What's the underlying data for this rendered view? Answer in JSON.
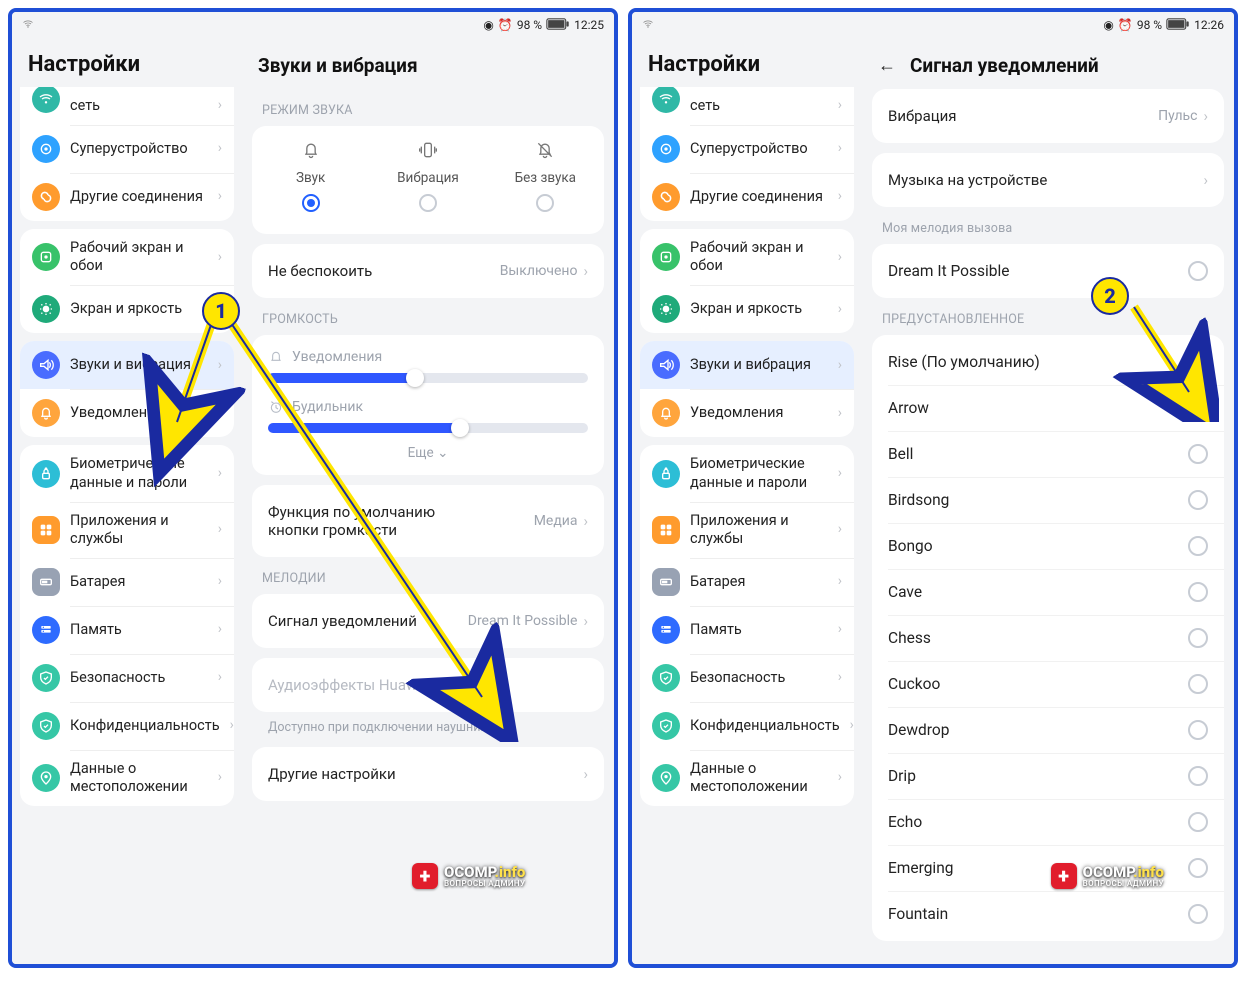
{
  "status": {
    "battery": "98 %",
    "time_left": "12:25",
    "time_right": "12:26"
  },
  "sidebar": {
    "title": "Настройки",
    "g1": [
      {
        "label": "сеть",
        "color": "i-teal",
        "half": true
      },
      {
        "label": "Суперустройство",
        "color": "i-blue2"
      },
      {
        "label": "Другие соединения",
        "color": "i-orange"
      }
    ],
    "g2": [
      {
        "label": "Рабочий экран и обои",
        "color": "i-green"
      },
      {
        "label": "Экран и яркость",
        "color": "i-dgreen"
      }
    ],
    "g3": [
      {
        "label": "Звуки и вибрация",
        "color": "i-blue",
        "active": true
      },
      {
        "label": "Уведомления",
        "color": "i-oran2"
      }
    ],
    "g4": [
      {
        "label": "Биометрические данные и пароли",
        "color": "i-cyan"
      },
      {
        "label": "Приложения и службы",
        "color": "i-orgsq"
      },
      {
        "label": "Батарея",
        "color": "i-gray"
      },
      {
        "label": "Память",
        "color": "i-bluesq"
      },
      {
        "label": "Безопасность",
        "color": "i-mint"
      },
      {
        "label": "Конфиденциальность",
        "color": "i-mint"
      },
      {
        "label": "Данные о местоположении",
        "color": "i-loc"
      }
    ]
  },
  "left_main": {
    "title": "Звуки и вибрация",
    "sound_mode_label": "РЕЖИМ ЗВУКА",
    "modes": {
      "sound": "Звук",
      "vibrate": "Вибрация",
      "silent": "Без звука"
    },
    "dnd": {
      "label": "Не беспокоить",
      "value": "Выключено"
    },
    "volume_label": "ГРОМКОСТЬ",
    "sliders": {
      "notif": "Уведомления",
      "alarm": "Будильник",
      "notif_pct": 46,
      "alarm_pct": 60
    },
    "more": "Еще",
    "vol_btn": {
      "label": "Функция по умолчанию кнопки громкости",
      "value": "Медиа"
    },
    "ringtones_label": "МЕЛОДИИ",
    "notif_sound": {
      "label": "Сигнал уведомлений",
      "value": "Dream It Possible"
    },
    "histen": {
      "label": "Аудиоэффекты Huawei Histen",
      "hint": "Доступно при подключении наушников"
    },
    "other": "Другие настройки"
  },
  "right_main": {
    "title": "Сигнал уведомлений",
    "vibration": {
      "label": "Вибрация",
      "value": "Пульс"
    },
    "music": "Музыка на устройстве",
    "my_label": "Моя мелодия вызова",
    "my_item": "Dream It Possible",
    "preset_label": "ПРЕДУСТАНОВЛЕННОЕ",
    "preset": [
      "Rise (По умолчанию)",
      "Arrow",
      "Bell",
      "Birdsong",
      "Bongo",
      "Cave",
      "Chess",
      "Cuckoo",
      "Dewdrop",
      "Drip",
      "Echo",
      "Emerging",
      "Fountain"
    ]
  },
  "annotations": {
    "num1": "1",
    "num2": "2"
  },
  "watermark": {
    "brand": "OCOMP",
    "tld": ".info",
    "tag": "ВОПРОСЫ АДМИНУ"
  }
}
